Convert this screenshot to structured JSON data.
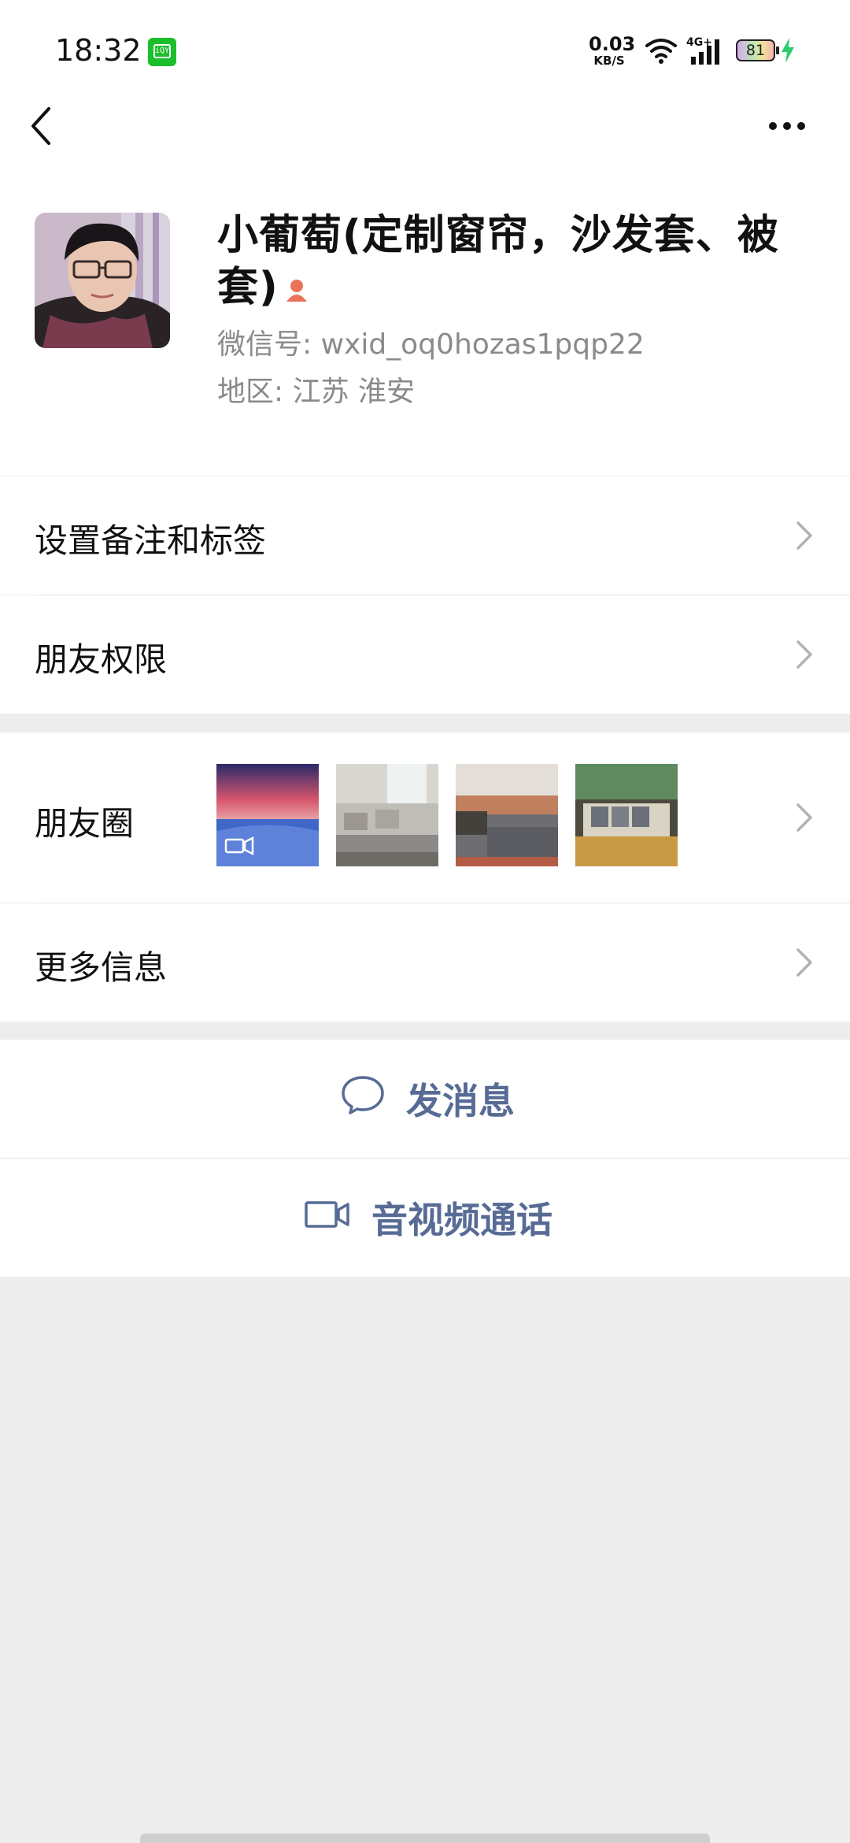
{
  "status_bar": {
    "time": "18:32",
    "app_icon": "iqiyi-icon",
    "net_speed_value": "0.03",
    "net_speed_unit": "KB/S",
    "network": "4G+",
    "battery": "81"
  },
  "profile": {
    "name": "小葡萄(定制窗帘，沙发套、被套)",
    "wechat_id": "微信号: wxid_oq0hozas1pqp22",
    "region": "地区: 江苏 淮安"
  },
  "cells": {
    "remark_tags": "设置备注和标签",
    "friend_permissions": "朋友权限",
    "moments": "朋友圈",
    "more_info": "更多信息"
  },
  "actions": {
    "message": "发消息",
    "av_call": "音视频通话"
  },
  "colors": {
    "accent": "#576b95",
    "background": "#ededed",
    "person_icon": "#e9735a"
  }
}
